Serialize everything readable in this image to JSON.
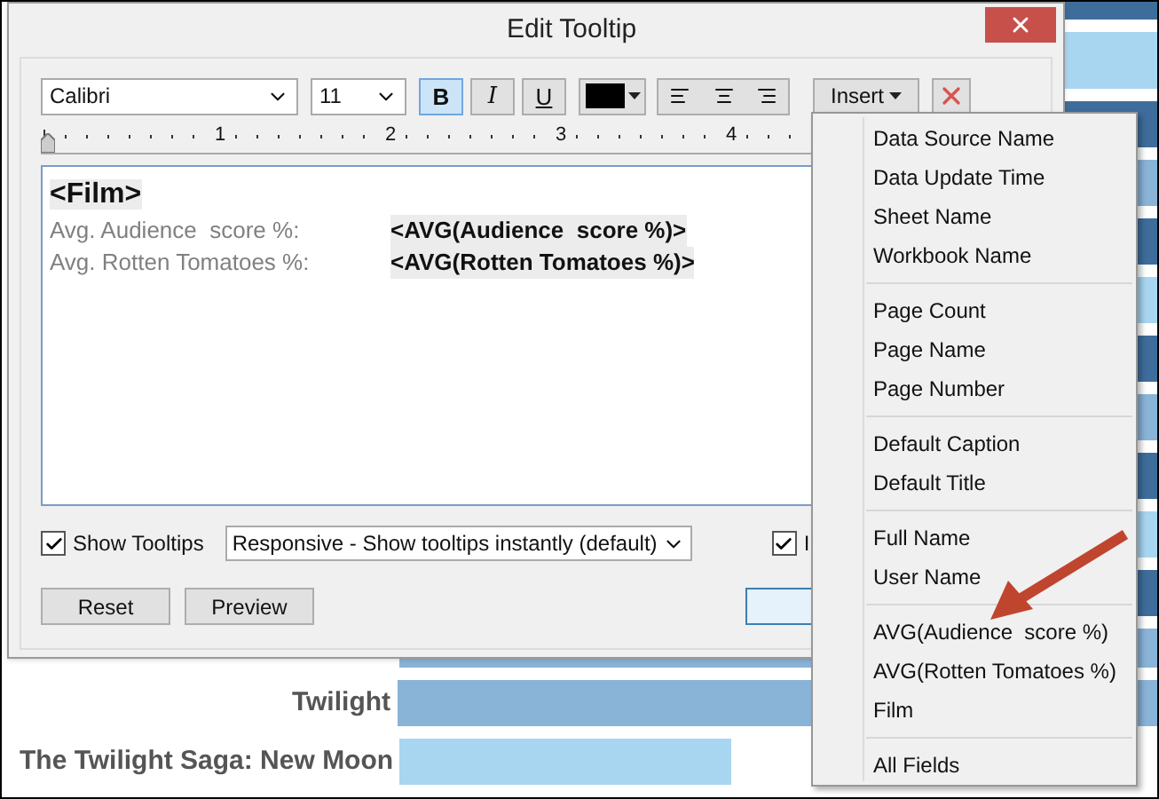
{
  "window": {
    "title": "Edit Tooltip"
  },
  "toolbar": {
    "font": "Calibri",
    "size": "11",
    "bold": true,
    "italic": false,
    "underline": false,
    "bold_label": "B",
    "italic_label": "I",
    "underline_label": "U",
    "insert_label": "Insert"
  },
  "ruler": {
    "labels": [
      "1",
      "2",
      "3",
      "4"
    ]
  },
  "editor": {
    "lines": [
      {
        "kind": "heading",
        "text": "<Film>"
      },
      {
        "kind": "field",
        "label": "Avg. Audience  score %:",
        "value": "<AVG(Audience  score %)>"
      },
      {
        "kind": "field",
        "label": "Avg. Rotten Tomatoes %:",
        "value": "<AVG(Rotten Tomatoes %)>"
      }
    ]
  },
  "show_tooltips": {
    "label": "Show Tooltips",
    "checked": true
  },
  "tooltip_mode": {
    "value": "Responsive - Show tooltips instantly (default)"
  },
  "second_option": {
    "label": "I",
    "checked": true
  },
  "buttons": [
    "Reset",
    "Preview"
  ],
  "insert_menu": {
    "groups": [
      [
        "Data Source Name",
        "Data Update Time",
        "Sheet Name",
        "Workbook Name"
      ],
      [
        "Page Count",
        "Page Name",
        "Page Number"
      ],
      [
        "Default Caption",
        "Default Title"
      ],
      [
        "Full Name",
        "User Name"
      ],
      [
        "AVG(Audience  score %)",
        "AVG(Rotten Tomatoes %)",
        "Film"
      ],
      [
        "All Fields"
      ]
    ]
  },
  "chart": {
    "rows": [
      {
        "label": "Twilight"
      },
      {
        "label": "The Twilight Saga: New Moon"
      }
    ]
  }
}
